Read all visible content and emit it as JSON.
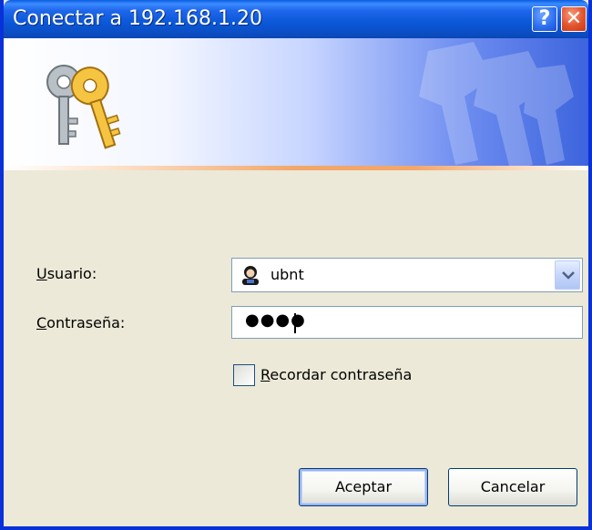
{
  "window": {
    "title": "Conectar a 192.168.1.20",
    "help_glyph": "?",
    "close_glyph": "✕"
  },
  "banner": {
    "icon": "keys-icon"
  },
  "form": {
    "user_label_mnemonic": "U",
    "user_label_rest": "suario:",
    "user_value": "ubnt",
    "password_label_mnemonic": "C",
    "password_label_rest": "ontraseña:",
    "password_masked": "●●●●",
    "remember_mnemonic": "R",
    "remember_rest": "ecordar contraseña",
    "remember_checked": false
  },
  "buttons": {
    "ok_label": "Aceptar",
    "cancel_label": "Cancelar"
  },
  "colors": {
    "titlebar": "#0a57d8",
    "window_border": "#0831d9",
    "dialog_bg": "#ece9d8",
    "accent_stripe": "#f2a66a"
  }
}
